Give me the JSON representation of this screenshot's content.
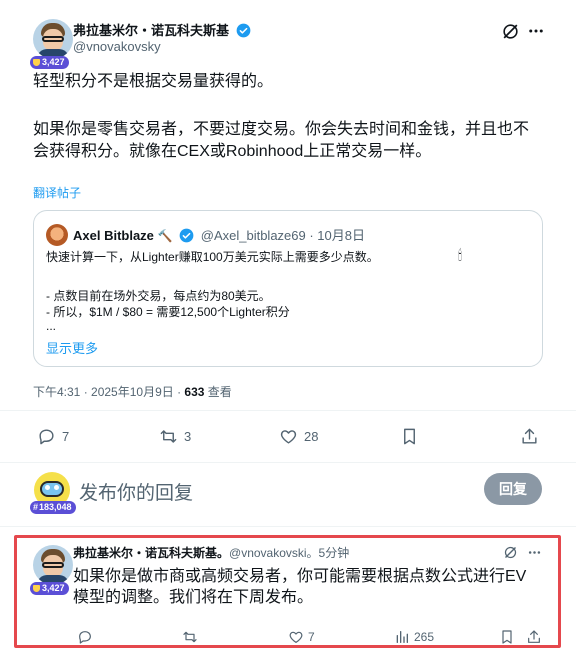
{
  "main_post": {
    "author_name": "弗拉基米尔・诺瓦科夫斯基",
    "handle": "@vnovakovsky",
    "badge_count": "3,427",
    "text_line1": "轻型积分不是根据交易量获得的。",
    "text_line2": "如果你是零售交易者，不要过度交易。你会失去时间和金钱，并且也不",
    "text_line3": "会获得积分。就像在CEX或Robinhood上正常交易一样。",
    "translate_label": "翻译帖子",
    "quote": {
      "author_name": "Axel Bitblaze",
      "author_emoji": "🔨",
      "handle_date": "@Axel_bitblaze69 · 10月8日",
      "line1": "快速计算一下，从Lighter赚取100万美元实际上需要多少点数。",
      "line2": "- 点数目前在场外交易，每点约为80美元。",
      "line3": "- 所以，$1M / $80 = 需要12,500个Lighter积分",
      "line4": "...",
      "show_more": "显示更多",
      "trailing_emoji": "🕯"
    },
    "timestamp": "下午4:31 · 2025年10月9日 · ",
    "views_count": "633",
    "views_label": " 查看",
    "actions": {
      "reply_count": "7",
      "retweet_count": "3",
      "like_count": "28"
    }
  },
  "compose": {
    "placeholder": "发布你的回复",
    "user_badge": "183,048",
    "reply_button": "回复"
  },
  "reply_post": {
    "author_name": "弗拉基米尔・诺瓦科夫斯基。",
    "handle_time": "@vnovakovski。5分钟",
    "badge_count": "3,427",
    "text_line1": "如果你是做市商或高频交易者，你可能需要根据点数公式进行EV",
    "text_line2": "模型的调整。我们将在下周发布。",
    "actions": {
      "like_count": "7",
      "views_count": "265"
    }
  },
  "colors": {
    "accent": "#1d9bf0",
    "highlight_border": "#e5484d",
    "badge": "#5b4fd6"
  }
}
